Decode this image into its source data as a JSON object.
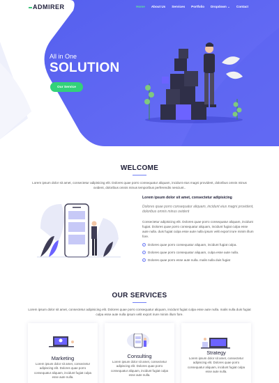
{
  "nav": {
    "logo": "ADMIRER",
    "items": [
      {
        "label": "Home",
        "active": true
      },
      {
        "label": "About Us",
        "active": false
      },
      {
        "label": "Services",
        "active": false
      },
      {
        "label": "Portfolio",
        "active": false
      },
      {
        "label": "Dropdown ⌄",
        "active": false
      },
      {
        "label": "Contact",
        "active": false
      }
    ]
  },
  "hero": {
    "small_title": "All in One",
    "big_title": "SOLUTION",
    "button_label": "Our Service"
  },
  "welcome": {
    "title": "WELCOME",
    "intro": "Lorem ipsum dolor sit amet, consectetur adipisicing elit. Dolores quae porro consequatur aliquam, incidunt eius magni provident, doloribus omnis minus ovident, doloribus omnis minus temporibus perferendis nesciunt..",
    "heading": "Lorem ipsum dolor sit amet, consectetur adipisicing",
    "italic": "Dolores quae porro consequatur aliquam, incidunt eius magni provident, doloribus omnis minus ovident",
    "body": "Consectetur adipisicing elit. Dolores quae porro consequatur aliquam, incidunt fugiat. Dolores quae porro consequatur aliquam, incidunt fugiat culpa esse aute nulla. duis fugiat culpa esse aute nulla ipsum velit export irure minim illum fore.",
    "checks": [
      "Dolores quae porro consequatur aliquam, incidunt fugiat culpa.",
      "Dolores quae porro consequatur aliquam, culpa esse aute nulla.",
      "Dolores quae porro esse aute nulla. malis nulla duis fugiat"
    ]
  },
  "services": {
    "title": "OUR SERVICES",
    "intro": "Lorem ipsum dolor sit amet, consectetur adipisicing elit. Dolores quae porro consequatur aliquam, incidunt fugiat culpa esse aute nulla. malis nulla duis fugiat culpa esse aute nulla ipsum velit export irure minim illum fore.",
    "cards": [
      {
        "name": "Marketing",
        "desc": "Lorem ipsum dolor sit amet, consectetur adipiscing elit. Dolores quae porro consequatur aliquam, incidunt fugiat culpa esse aute nulla."
      },
      {
        "name": "Consulting",
        "desc": "Lorem ipsum dolor sit amet, consectetur adipiscing elit. Dolores quae porro consequatur aliquam, incidunt fugiat culpa esse aute nulla."
      },
      {
        "name": "Strategy",
        "desc": "Lorem ipsum dolor sit amet, consectetur adipiscing elit. Dolores quae porro consequatur aliquam, incidunt fugiat culpa esse aute nulla."
      }
    ]
  },
  "colors": {
    "hero_blue": "#4f5bf0",
    "accent_green": "#33d17a",
    "title_dark": "#1d1d36",
    "accent_purple": "#6e7df5"
  }
}
